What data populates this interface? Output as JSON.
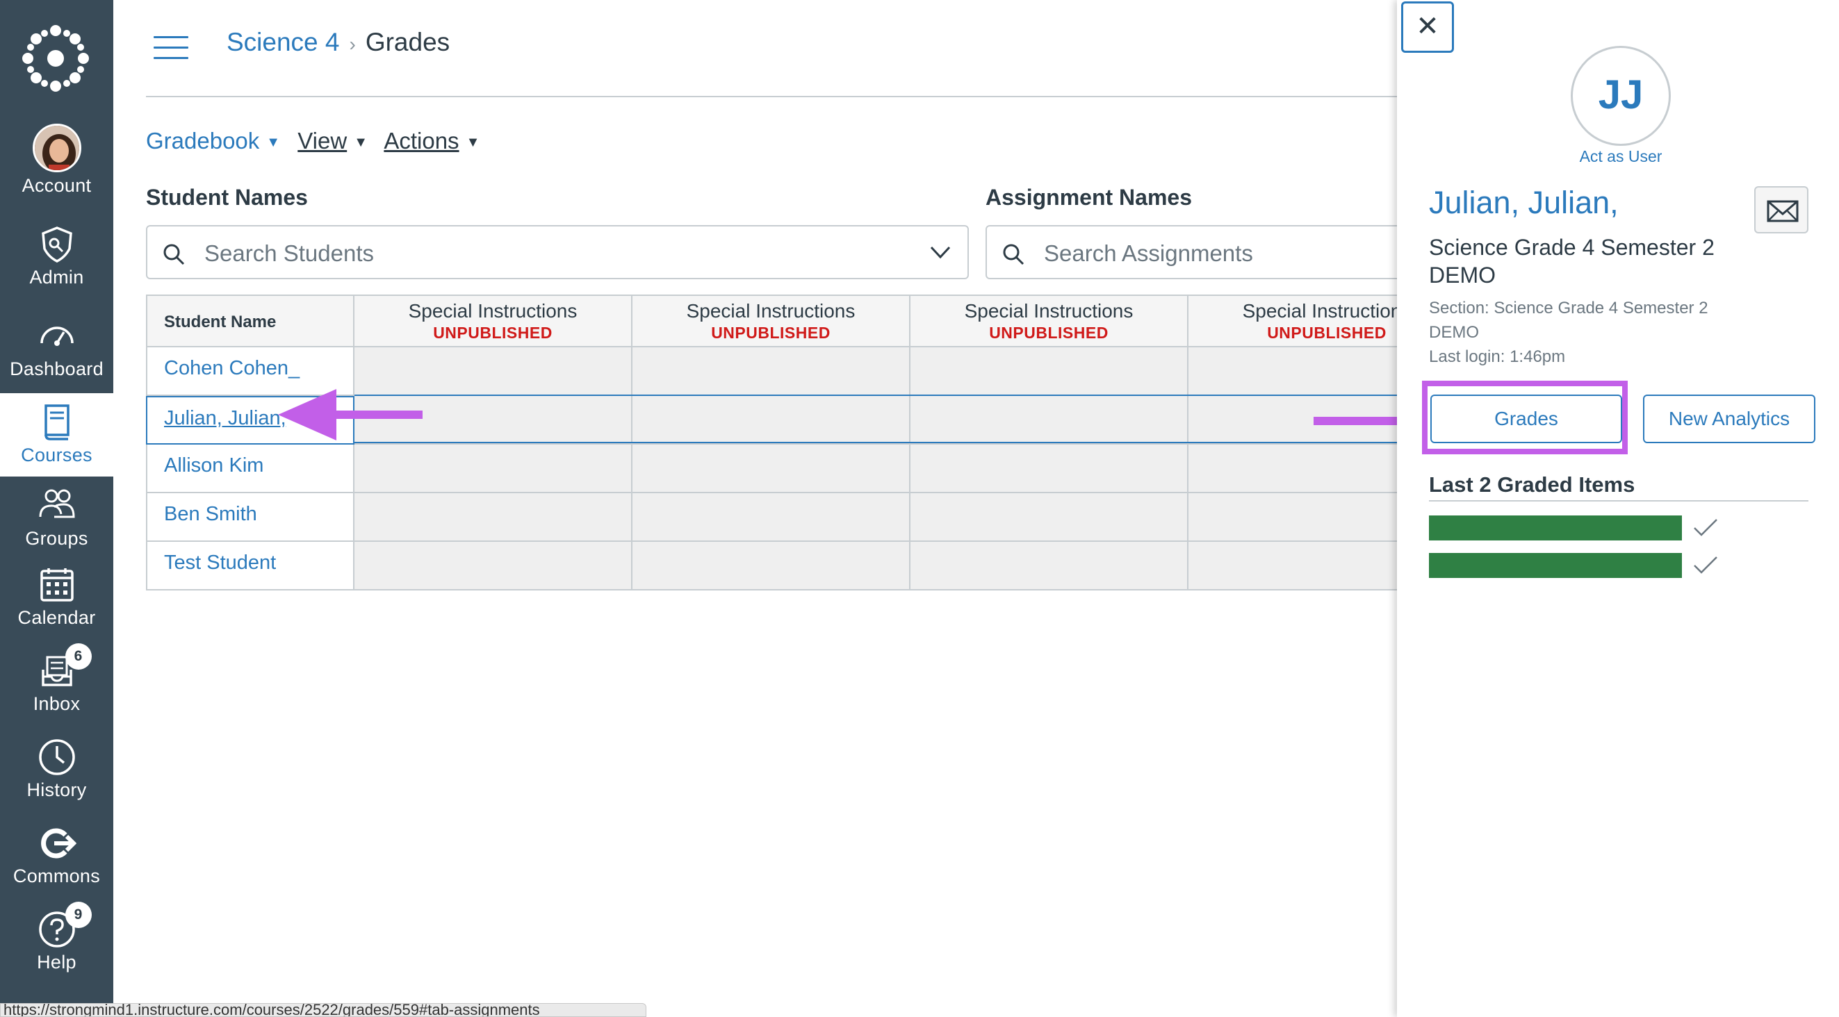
{
  "global_nav": {
    "items": [
      {
        "label": "Account",
        "icon": "avatar"
      },
      {
        "label": "Admin",
        "icon": "shield-icon"
      },
      {
        "label": "Dashboard",
        "icon": "speedometer-icon"
      },
      {
        "label": "Courses",
        "icon": "book-icon"
      },
      {
        "label": "Groups",
        "icon": "people-icon"
      },
      {
        "label": "Calendar",
        "icon": "calendar-icon"
      },
      {
        "label": "Inbox",
        "icon": "inbox-icon",
        "badge": "6"
      },
      {
        "label": "History",
        "icon": "clock-icon"
      },
      {
        "label": "Commons",
        "icon": "commons-icon"
      },
      {
        "label": "Help",
        "icon": "help-icon",
        "badge": "9"
      }
    ],
    "active": "Courses",
    "bg_color": "#394b58"
  },
  "breadcrumb": {
    "course": "Science 4",
    "page": "Grades"
  },
  "toolbar": {
    "gradebook": "Gradebook",
    "view": "View",
    "actions": "Actions"
  },
  "student_search": {
    "label": "Student Names",
    "placeholder": "Search Students"
  },
  "assignment_search": {
    "label": "Assignment Names",
    "placeholder": "Search Assignments"
  },
  "grid": {
    "name_header": "Student Name",
    "columns": [
      {
        "title": "Special Instructions",
        "status": "UNPUBLISHED"
      },
      {
        "title": "Special Instructions",
        "status": "UNPUBLISHED"
      },
      {
        "title": "Special Instructions",
        "status": "UNPUBLISHED"
      },
      {
        "title": "Special Instructions",
        "status": "UNPUBLISHED"
      }
    ],
    "students": [
      "Cohen Cohen_",
      "Julian, Julian,",
      "Allison Kim",
      "Ben Smith",
      "Test Student"
    ],
    "selected_student": "Julian, Julian,"
  },
  "status_url": "https://strongmind1.instructure.com/courses/2522/grades/559#tab-assignments",
  "tray": {
    "initials": "JJ",
    "act_as_user": "Act as User",
    "name": "Julian, Julian,",
    "course": "Science Grade 4 Semester 2 DEMO",
    "section_line1": "Section: Science Grade 4 Semester 2",
    "section_line2": "DEMO",
    "last_login": "Last login: 1:46pm",
    "grades_button": "Grades",
    "analytics_button": "New Analytics",
    "last_graded_title": "Last 2 Graded Items",
    "graded_items": [
      {
        "status": "graded"
      },
      {
        "status": "graded"
      }
    ]
  },
  "colors": {
    "link": "#2b7abc",
    "unpublished": "#d01a19",
    "annotation": "#c25fe8",
    "graded_bar": "#2f8044"
  }
}
